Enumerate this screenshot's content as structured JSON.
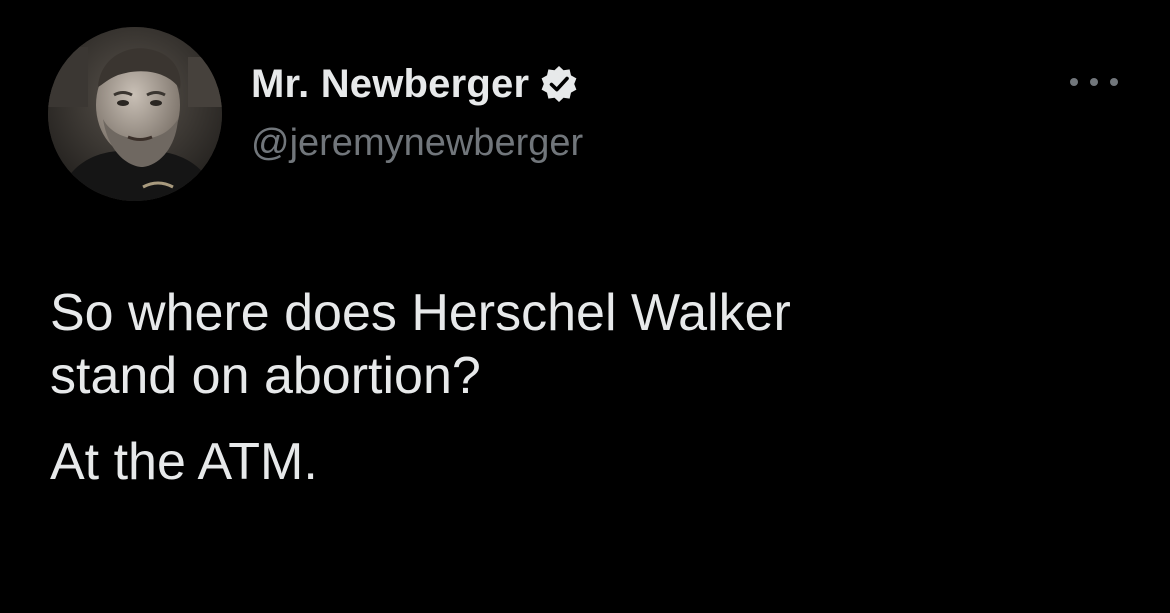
{
  "author": {
    "display_name": "Mr. Newberger",
    "handle": "@jeremynewberger",
    "verified": true
  },
  "tweet": {
    "lines": [
      "So where does Herschel Walker",
      "stand on abortion?"
    ],
    "punchline": "At the ATM."
  },
  "icons": {
    "verified": "verified-badge-icon",
    "more": "more-options-icon"
  },
  "colors": {
    "background": "#000000",
    "text": "#e7e9ea",
    "secondary_text": "#71767b"
  }
}
